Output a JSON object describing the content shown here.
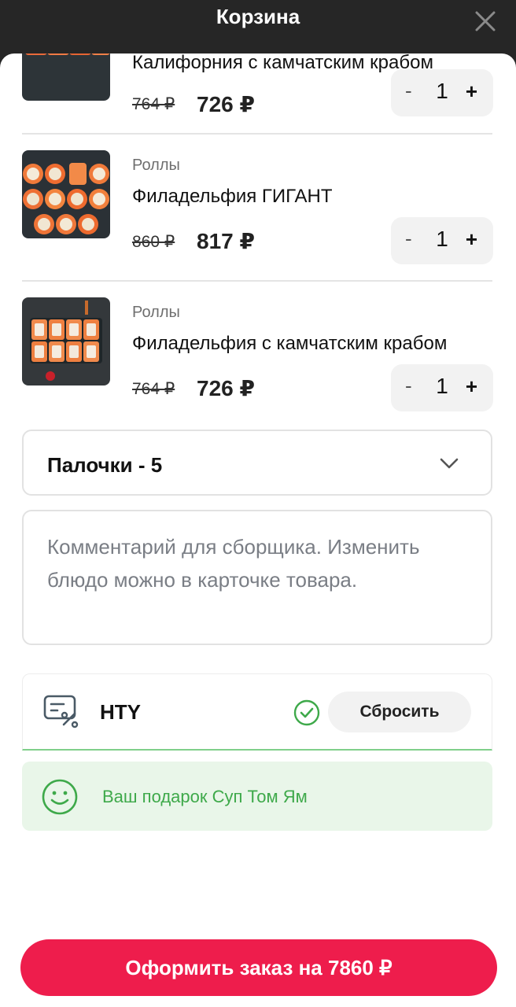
{
  "header": {
    "title": "Корзина"
  },
  "items": [
    {
      "category": "",
      "name": "Калифорния с камчатским крабом",
      "old_price": "764 ₽",
      "price": "726 ₽",
      "qty": "1"
    },
    {
      "category": "Роллы",
      "name": "Филадельфия ГИГАНТ",
      "old_price": "860 ₽",
      "price": "817 ₽",
      "qty": "1"
    },
    {
      "category": "Роллы",
      "name": "Филадельфия с камчатским крабом",
      "old_price": "764 ₽",
      "price": "726 ₽",
      "qty": "1"
    }
  ],
  "stepper": {
    "minus": "-",
    "plus": "+"
  },
  "sticks": {
    "label": "Палочки - 5"
  },
  "comment": {
    "placeholder": "Комментарий для сборщика. Изменить блюдо можно в карточке товара."
  },
  "promo": {
    "code": "HTY",
    "reset_label": "Сбросить"
  },
  "gift": {
    "text": "Ваш подарок Суп Том Ям"
  },
  "checkout": {
    "label": "Оформить заказ на 7860 ₽"
  },
  "colors": {
    "accent": "#ee1d4c",
    "success": "#3ea94a",
    "success_bg": "#e9f6e9",
    "header_bg": "#262626"
  }
}
